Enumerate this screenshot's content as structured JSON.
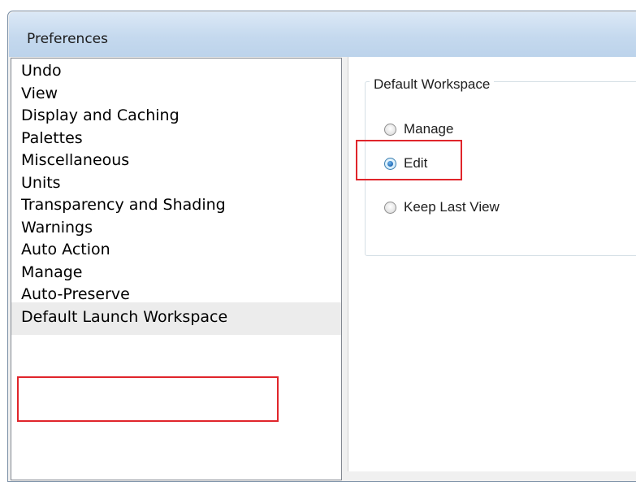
{
  "window": {
    "title": "Preferences"
  },
  "categories": [
    {
      "label": "Undo",
      "selected": false
    },
    {
      "label": "View",
      "selected": false
    },
    {
      "label": "Display and Caching",
      "selected": false
    },
    {
      "label": "Palettes",
      "selected": false
    },
    {
      "label": "Miscellaneous",
      "selected": false
    },
    {
      "label": "Units",
      "selected": false
    },
    {
      "label": "Transparency and Shading",
      "selected": false
    },
    {
      "label": "Warnings",
      "selected": false
    },
    {
      "label": "Auto Action",
      "selected": false
    },
    {
      "label": "Manage",
      "selected": false
    },
    {
      "label": "Auto-Preserve",
      "selected": false
    },
    {
      "label": "Default Launch Workspace",
      "selected": true
    }
  ],
  "workspace_group": {
    "legend": "Default Workspace",
    "options": [
      {
        "label": "Manage",
        "checked": false
      },
      {
        "label": "Edit",
        "checked": true
      },
      {
        "label": "Keep Last View",
        "checked": false
      }
    ]
  },
  "colors": {
    "highlight": "#e0252b",
    "titlebar": "#c5d9ee",
    "radio_checked": "#1f66b3"
  }
}
